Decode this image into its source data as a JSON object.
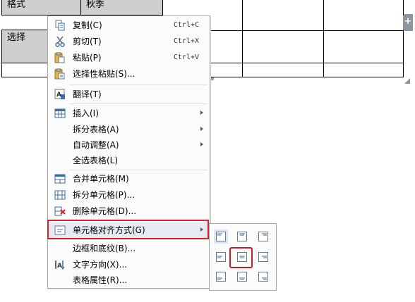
{
  "table": {
    "cells": {
      "format_label": "格式",
      "autumn_label": "秋季",
      "select_label": "选择"
    }
  },
  "context_menu": {
    "items": [
      {
        "id": "copy",
        "label": "复制(C)",
        "shortcut": "Ctrl+C",
        "icon": "copy-icon"
      },
      {
        "id": "cut",
        "label": "剪切(T)",
        "shortcut": "Ctrl+X",
        "icon": "scissors-icon"
      },
      {
        "id": "paste",
        "label": "粘贴(P)",
        "shortcut": "Ctrl+V",
        "icon": "paste-icon"
      },
      {
        "id": "paste-special",
        "label": "选择性粘贴(S)...",
        "icon": "paste-special-icon"
      },
      {
        "id": "translate",
        "label": "翻译(T)",
        "icon": "translate-icon"
      },
      {
        "id": "insert",
        "label": "插入(I)",
        "icon": "table-insert-icon",
        "submenu": true
      },
      {
        "id": "split-table",
        "label": "拆分表格(A)",
        "submenu": true
      },
      {
        "id": "autofit",
        "label": "自动调整(A)",
        "submenu": true
      },
      {
        "id": "select-table",
        "label": "全选表格(L)"
      },
      {
        "id": "merge-cells",
        "label": "合并单元格(M)",
        "icon": "merge-cells-icon"
      },
      {
        "id": "split-cells",
        "label": "拆分单元格(P)...",
        "icon": "split-cells-icon"
      },
      {
        "id": "delete-cells",
        "label": "删除单元格(D)...",
        "icon": "delete-cells-icon"
      },
      {
        "id": "cell-align",
        "label": "单元格对齐方式(G)",
        "icon": "cell-align-icon",
        "submenu": true,
        "highlighted": true
      },
      {
        "id": "borders-shading",
        "label": "边框和底纹(B)..."
      },
      {
        "id": "text-direction",
        "label": "文字方向(X)...",
        "icon": "text-direction-icon"
      },
      {
        "id": "table-properties",
        "label": "表格属性(R)..."
      }
    ]
  },
  "alignment_submenu": {
    "options": [
      {
        "row": "top",
        "col": "left",
        "icon": "align-top-left-icon",
        "selected": true
      },
      {
        "row": "top",
        "col": "center",
        "icon": "align-top-center-icon"
      },
      {
        "row": "top",
        "col": "right",
        "icon": "align-top-right-icon"
      },
      {
        "row": "middle",
        "col": "left",
        "icon": "align-middle-left-icon"
      },
      {
        "row": "middle",
        "col": "center",
        "icon": "align-middle-center-icon",
        "highlighted": true
      },
      {
        "row": "middle",
        "col": "right",
        "icon": "align-middle-right-icon"
      },
      {
        "row": "bottom",
        "col": "left",
        "icon": "align-bottom-left-icon"
      },
      {
        "row": "bottom",
        "col": "center",
        "icon": "align-bottom-center-icon"
      },
      {
        "row": "bottom",
        "col": "right",
        "icon": "align-bottom-right-icon"
      }
    ]
  },
  "colors": {
    "highlight_border": "#d9202a",
    "selected_cell_bg": "#cfcfcf",
    "menu_hover_bg": "#e5eaf3",
    "icon_blue": "#3a6ea5"
  }
}
